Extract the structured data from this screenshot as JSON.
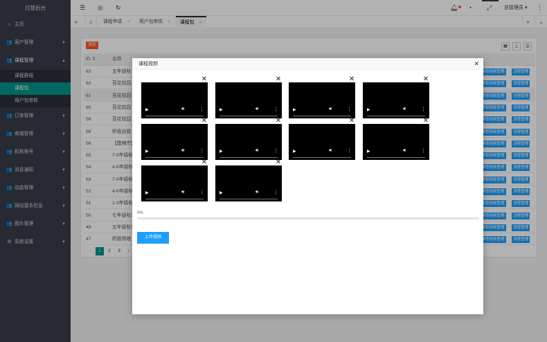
{
  "brand": "日慧后台",
  "sidebar": {
    "items": [
      {
        "label": "主页",
        "icon": "home-icon",
        "glyph": "⌂"
      },
      {
        "label": "客户管理",
        "icon": "users-icon",
        "glyph": "👥"
      },
      {
        "label": "课程管理",
        "icon": "users-icon",
        "glyph": "👥",
        "open": true
      },
      {
        "label": "订单管理",
        "icon": "users-icon",
        "glyph": "👥"
      },
      {
        "label": "商城管理",
        "icon": "users-icon",
        "glyph": "👥"
      },
      {
        "label": "机构账号",
        "icon": "users-icon",
        "glyph": "👥"
      },
      {
        "label": "消息通知",
        "icon": "users-icon",
        "glyph": "👥"
      },
      {
        "label": "动态管理",
        "icon": "users-icon",
        "glyph": "👥"
      },
      {
        "label": "网站基本信息",
        "icon": "users-icon",
        "glyph": "👥"
      },
      {
        "label": "图片管理",
        "icon": "users-icon",
        "glyph": "👥"
      },
      {
        "label": "系统设置",
        "icon": "gear-icon",
        "glyph": "⚙"
      }
    ],
    "sub_items": [
      "课程群组",
      "课程包",
      "用户包审核"
    ]
  },
  "header": {
    "user": "总管理员"
  },
  "tabs": [
    "课程申请",
    "用户包审核",
    "课程包"
  ],
  "table": {
    "add_label": "添加",
    "col_id": "ID",
    "col_name": "名称",
    "rows": [
      {
        "id": "63",
        "name": "五年级秋"
      },
      {
        "id": "62",
        "name": "苔花校园"
      },
      {
        "id": "61",
        "name": "苔花校园"
      },
      {
        "id": "60",
        "name": "苔花校园"
      },
      {
        "id": "59",
        "name": "苔花校园"
      },
      {
        "id": "58",
        "name": "积极自我"
      },
      {
        "id": "56",
        "name": "【腊辣市】"
      },
      {
        "id": "55",
        "name": "7-9年级秋"
      },
      {
        "id": "54",
        "name": "4-6年级秋"
      },
      {
        "id": "53",
        "name": "7-9年级秋"
      },
      {
        "id": "52",
        "name": "4-6年级秋"
      },
      {
        "id": "51",
        "name": "1-3年级秋"
      },
      {
        "id": "50",
        "name": "七年级秋季"
      },
      {
        "id": "49",
        "name": "五年级秋季"
      },
      {
        "id": "47",
        "name": "积极情绪"
      }
    ],
    "op_video": "课程视频管理",
    "op_flow": "流程管理",
    "pages": [
      "1",
      "2",
      "3"
    ]
  },
  "modal": {
    "title": "课程视频",
    "progress_label": "0%",
    "progress": 0,
    "upload_label": "上传视频",
    "video_count": 10,
    "remove_glyph": "✕"
  }
}
